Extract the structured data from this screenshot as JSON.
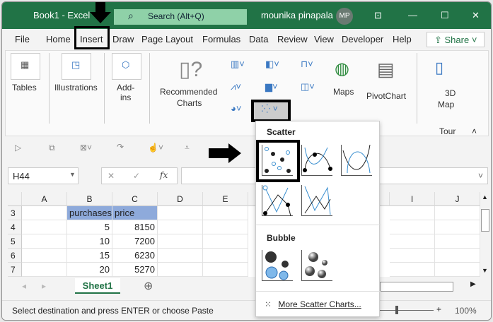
{
  "titlebar": {
    "title": "Book1  -  Excel",
    "search_placeholder": "Search (Alt+Q)",
    "user_name": "mounika pinapala",
    "user_initials": "MP",
    "accent": "#217346"
  },
  "tabs": [
    "File",
    "Home",
    "Insert",
    "Draw",
    "Page Layout",
    "Formulas",
    "Data",
    "Review",
    "View",
    "Developer",
    "Help"
  ],
  "active_tab": "Insert",
  "share_label": "Share",
  "ribbon": {
    "tables": "Tables",
    "illustrations": "Illustrations",
    "addins": "Add-\nins",
    "recommended": "Recommended",
    "charts": "Charts",
    "maps": "Maps",
    "pivotchart": "PivotChart",
    "threed": "3D",
    "maps2": "Map",
    "tours": "Tour"
  },
  "namebox": "H44",
  "fx": "fx",
  "columns": [
    "A",
    "B",
    "C",
    "D",
    "E",
    "I",
    "J"
  ],
  "rows": [
    {
      "num": "3",
      "B": "purchases",
      "C": "price"
    },
    {
      "num": "4",
      "B": "5",
      "C": "8150"
    },
    {
      "num": "5",
      "B": "10",
      "C": "7200"
    },
    {
      "num": "6",
      "B": "15",
      "C": "6230"
    },
    {
      "num": "7",
      "B": "20",
      "C": "5270"
    }
  ],
  "sheet_tab": "Sheet1",
  "status_text": "Select destination and press ENTER or choose Paste",
  "zoom_level": "100%",
  "dropdown": {
    "scatter_heading": "Scatter",
    "bubble_heading": "Bubble",
    "more_label": "More Scatter Charts..."
  }
}
